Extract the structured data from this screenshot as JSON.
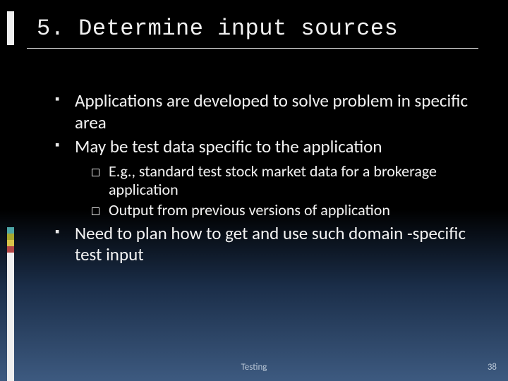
{
  "title": "5. Determine input sources",
  "bullets": [
    {
      "text": "Applications are developed to solve problem in specific area"
    },
    {
      "text": "May be test data specific to the application",
      "sub": [
        "E.g., standard test stock market data for a brokerage application",
        "Output from previous versions of application"
      ]
    },
    {
      "text": "Need to plan how to get and use such domain -specific test input"
    }
  ],
  "footer": {
    "label": "Testing",
    "page": "38"
  }
}
